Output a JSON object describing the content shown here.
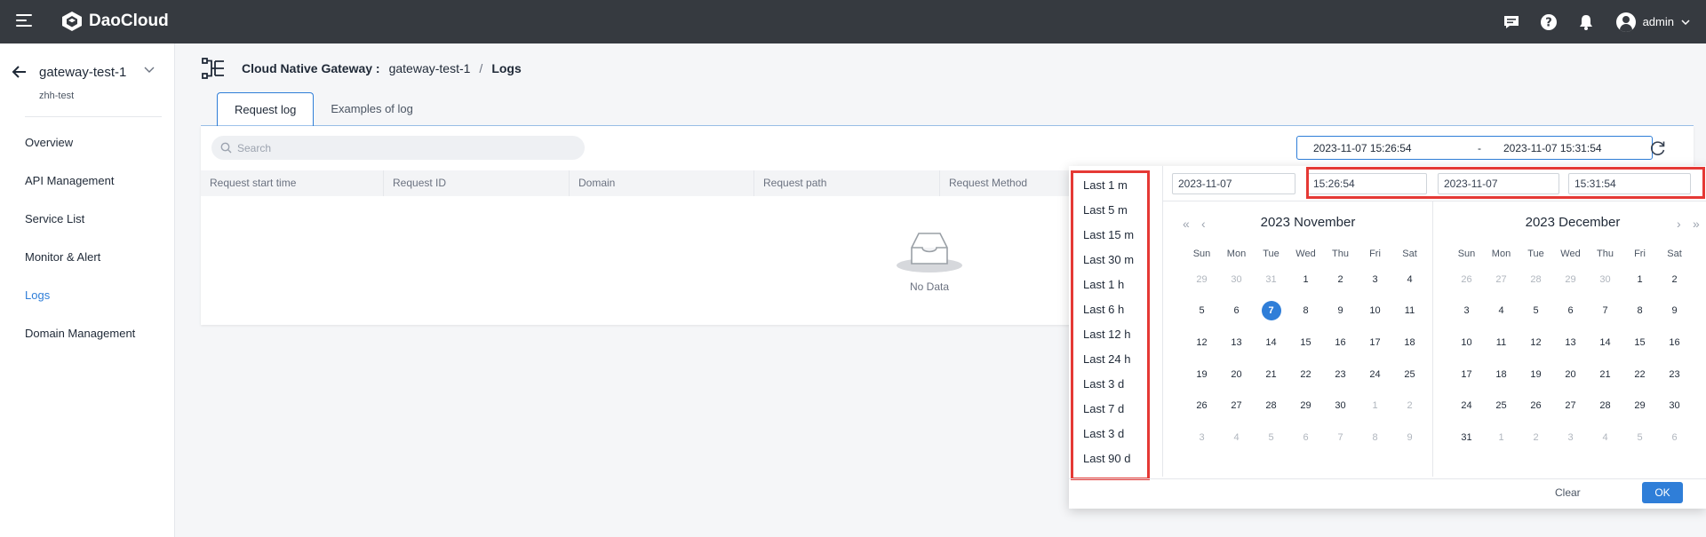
{
  "topbar": {
    "brand": "DaoCloud",
    "user": "admin"
  },
  "sidebar": {
    "title": "gateway-test-1",
    "subtitle": "zhh-test",
    "items": [
      {
        "label": "Overview"
      },
      {
        "label": "API Management"
      },
      {
        "label": "Service List"
      },
      {
        "label": "Monitor & Alert"
      },
      {
        "label": "Logs",
        "active": true
      },
      {
        "label": "Domain Management"
      }
    ]
  },
  "breadcrumb": {
    "section": "Cloud Native Gateway :",
    "instance": "gateway-test-1",
    "sep": "/",
    "page": "Logs"
  },
  "tabs": [
    {
      "label": "Request log",
      "active": true
    },
    {
      "label": "Examples of log"
    }
  ],
  "search": {
    "placeholder": "Search"
  },
  "range": {
    "start": "2023-11-07 15:26:54",
    "sep": "-",
    "end": "2023-11-07 15:31:54"
  },
  "table": {
    "columns": [
      "Request start time",
      "Request ID",
      "Domain",
      "Request path",
      "Request Method"
    ],
    "empty_text": "No Data"
  },
  "picker": {
    "quick_ranges": [
      "Last 1 m",
      "Last 5 m",
      "Last 15 m",
      "Last 30 m",
      "Last 1 h",
      "Last 6 h",
      "Last 12 h",
      "Last 24 h",
      "Last 3 d",
      "Last 7 d",
      "Last 3 d",
      "Last 90 d"
    ],
    "start_date": "2023-11-07",
    "start_time": "15:26:54",
    "end_date": "2023-11-07",
    "end_time": "15:31:54",
    "weekdays": [
      "Sun",
      "Mon",
      "Tue",
      "Wed",
      "Thu",
      "Fri",
      "Sat"
    ],
    "left_month": {
      "title": "2023 November",
      "days": [
        {
          "d": "29",
          "m": true
        },
        {
          "d": "30",
          "m": true
        },
        {
          "d": "31",
          "m": true
        },
        {
          "d": "1"
        },
        {
          "d": "2"
        },
        {
          "d": "3"
        },
        {
          "d": "4"
        },
        {
          "d": "5"
        },
        {
          "d": "6"
        },
        {
          "d": "7",
          "s": true
        },
        {
          "d": "8"
        },
        {
          "d": "9"
        },
        {
          "d": "10"
        },
        {
          "d": "11"
        },
        {
          "d": "12"
        },
        {
          "d": "13"
        },
        {
          "d": "14"
        },
        {
          "d": "15"
        },
        {
          "d": "16"
        },
        {
          "d": "17"
        },
        {
          "d": "18"
        },
        {
          "d": "19"
        },
        {
          "d": "20"
        },
        {
          "d": "21"
        },
        {
          "d": "22"
        },
        {
          "d": "23"
        },
        {
          "d": "24"
        },
        {
          "d": "25"
        },
        {
          "d": "26"
        },
        {
          "d": "27"
        },
        {
          "d": "28"
        },
        {
          "d": "29"
        },
        {
          "d": "30"
        },
        {
          "d": "1",
          "m": true
        },
        {
          "d": "2",
          "m": true
        },
        {
          "d": "3",
          "m": true
        },
        {
          "d": "4",
          "m": true
        },
        {
          "d": "5",
          "m": true
        },
        {
          "d": "6",
          "m": true
        },
        {
          "d": "7",
          "m": true
        },
        {
          "d": "8",
          "m": true
        },
        {
          "d": "9",
          "m": true
        }
      ]
    },
    "right_month": {
      "title": "2023 December",
      "days": [
        {
          "d": "26",
          "m": true
        },
        {
          "d": "27",
          "m": true
        },
        {
          "d": "28",
          "m": true
        },
        {
          "d": "29",
          "m": true
        },
        {
          "d": "30",
          "m": true
        },
        {
          "d": "1"
        },
        {
          "d": "2"
        },
        {
          "d": "3"
        },
        {
          "d": "4"
        },
        {
          "d": "5"
        },
        {
          "d": "6"
        },
        {
          "d": "7"
        },
        {
          "d": "8"
        },
        {
          "d": "9"
        },
        {
          "d": "10"
        },
        {
          "d": "11"
        },
        {
          "d": "12"
        },
        {
          "d": "13"
        },
        {
          "d": "14"
        },
        {
          "d": "15"
        },
        {
          "d": "16"
        },
        {
          "d": "17"
        },
        {
          "d": "18"
        },
        {
          "d": "19"
        },
        {
          "d": "20"
        },
        {
          "d": "21"
        },
        {
          "d": "22"
        },
        {
          "d": "23"
        },
        {
          "d": "24"
        },
        {
          "d": "25"
        },
        {
          "d": "26"
        },
        {
          "d": "27"
        },
        {
          "d": "28"
        },
        {
          "d": "29"
        },
        {
          "d": "30"
        },
        {
          "d": "31"
        },
        {
          "d": "1",
          "m": true
        },
        {
          "d": "2",
          "m": true
        },
        {
          "d": "3",
          "m": true
        },
        {
          "d": "4",
          "m": true
        },
        {
          "d": "5",
          "m": true
        },
        {
          "d": "6",
          "m": true
        }
      ]
    },
    "clear_label": "Clear",
    "ok_label": "OK"
  },
  "colors": {
    "accent": "#2f7ed8",
    "topbar": "#363a40",
    "highlight": "#e53935"
  }
}
